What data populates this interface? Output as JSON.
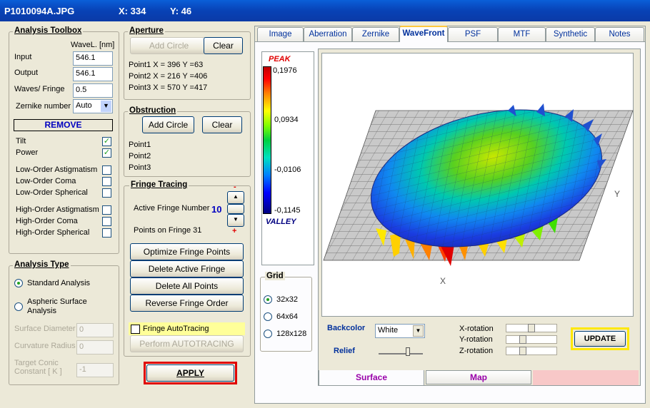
{
  "titlebar": {
    "filename": "P1010094A.JPG",
    "x": "X: 334",
    "y": "Y: 46"
  },
  "toolbox": {
    "title": "Analysis Toolbox",
    "wavel_label": "WaveL. [nm]",
    "input_label": "Input",
    "input_value": "546.1",
    "output_label": "Output",
    "output_value": "546.1",
    "waves_label": "Waves/ Fringe",
    "waves_value": "0.5",
    "zernike_label": "Zernike number",
    "zernike_value": "Auto",
    "remove_label": "REMOVE",
    "terms": [
      {
        "label": "Tilt",
        "checked": "✓"
      },
      {
        "label": "Power",
        "checked": "✓"
      },
      {
        "label": "Low-Order  Astigmatism",
        "checked": ""
      },
      {
        "label": "Low-Order  Coma",
        "checked": ""
      },
      {
        "label": "Low-Order  Spherical",
        "checked": ""
      },
      {
        "label": "High-Order  Astigmatism",
        "checked": ""
      },
      {
        "label": "High-Order  Coma",
        "checked": ""
      },
      {
        "label": "High-Order  Spherical",
        "checked": ""
      }
    ]
  },
  "aperture": {
    "title": "Aperture",
    "add_circle": "Add Circle",
    "clear": "Clear",
    "p1": "Point1  X =   396   Y =63",
    "p2": "Point2  X =   216   Y =406",
    "p3": "Point3  X =   570   Y =417"
  },
  "obstruction": {
    "title": "Obstruction",
    "add_circle": "Add Circle",
    "clear": "Clear",
    "p1": "Point1",
    "p2": "Point2",
    "p3": "Point3"
  },
  "fringe": {
    "title": "Fringe Tracing",
    "active_label": "Active Fringe Number",
    "active_value": "10",
    "points_label": "Points on  Fringe 31",
    "minus": "-",
    "plus": "+",
    "optimize": "Optimize Fringe Points",
    "delete_active": "Delete Active Fringe",
    "delete_all": "Delete  All  Points",
    "reverse": "Reverse  Fringe Order",
    "autotracing_label": "Fringe AutoTracing",
    "perform": "Perform  AUTOTRACING"
  },
  "analysis": {
    "title": "Analysis Type",
    "standard": "Standard  Analysis",
    "aspheric1": "Aspheric  Surface",
    "aspheric2": "Analysis",
    "surface_diam": "Surface Diameter",
    "surface_diam_value": "0",
    "curv_radius": "Curvature Radius",
    "curv_radius_value": "0",
    "target1": "Target Conic",
    "target2": "Constant [ K ]",
    "target_value": "-1"
  },
  "apply": "APPLY",
  "tabs": [
    "Image",
    "Aberration",
    "Zernike",
    "WaveFront",
    "PSF",
    "MTF",
    "Synthetic",
    "Notes"
  ],
  "active_tab": "WaveFront",
  "colorbar": {
    "peak": "PEAK",
    "valley": "VALLEY",
    "v1": "0,1976",
    "v2": "0,0934",
    "v3": "-0,0106",
    "v4": "-0,1145"
  },
  "grid": {
    "title": "Grid",
    "opt1": "32x32",
    "opt2": "64x64",
    "opt3": "128x128"
  },
  "plot": {
    "x_axis": "X",
    "y_axis": "Y"
  },
  "controls": {
    "backcolor_label": "Backcolor",
    "backcolor_value": "White",
    "relief_label": "Relief",
    "xrot": "X-rotation",
    "yrot": "Y-rotation",
    "zrot": "Z-rotation",
    "update": "UPDATE"
  },
  "bottom_tabs": {
    "surface": "Surface",
    "map": "Map"
  }
}
